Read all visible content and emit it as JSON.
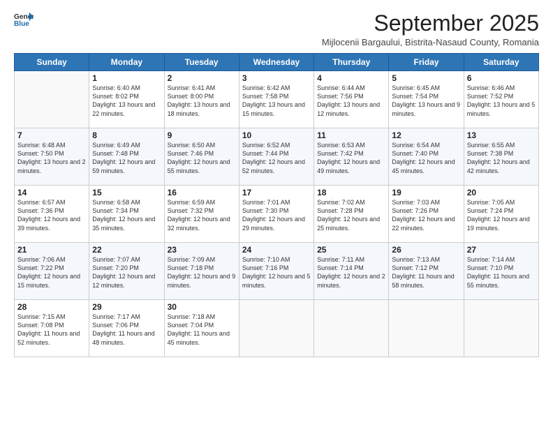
{
  "logo": {
    "line1": "General",
    "line2": "Blue"
  },
  "title": "September 2025",
  "subtitle": "Mijlocenii Bargaului, Bistrita-Nasaud County, Romania",
  "days_header": [
    "Sunday",
    "Monday",
    "Tuesday",
    "Wednesday",
    "Thursday",
    "Friday",
    "Saturday"
  ],
  "weeks": [
    [
      {
        "day": "",
        "info": ""
      },
      {
        "day": "1",
        "info": "Sunrise: 6:40 AM\nSunset: 8:02 PM\nDaylight: 13 hours\nand 22 minutes."
      },
      {
        "day": "2",
        "info": "Sunrise: 6:41 AM\nSunset: 8:00 PM\nDaylight: 13 hours\nand 18 minutes."
      },
      {
        "day": "3",
        "info": "Sunrise: 6:42 AM\nSunset: 7:58 PM\nDaylight: 13 hours\nand 15 minutes."
      },
      {
        "day": "4",
        "info": "Sunrise: 6:44 AM\nSunset: 7:56 PM\nDaylight: 13 hours\nand 12 minutes."
      },
      {
        "day": "5",
        "info": "Sunrise: 6:45 AM\nSunset: 7:54 PM\nDaylight: 13 hours\nand 9 minutes."
      },
      {
        "day": "6",
        "info": "Sunrise: 6:46 AM\nSunset: 7:52 PM\nDaylight: 13 hours\nand 5 minutes."
      }
    ],
    [
      {
        "day": "7",
        "info": "Sunrise: 6:48 AM\nSunset: 7:50 PM\nDaylight: 13 hours\nand 2 minutes."
      },
      {
        "day": "8",
        "info": "Sunrise: 6:49 AM\nSunset: 7:48 PM\nDaylight: 12 hours\nand 59 minutes."
      },
      {
        "day": "9",
        "info": "Sunrise: 6:50 AM\nSunset: 7:46 PM\nDaylight: 12 hours\nand 55 minutes."
      },
      {
        "day": "10",
        "info": "Sunrise: 6:52 AM\nSunset: 7:44 PM\nDaylight: 12 hours\nand 52 minutes."
      },
      {
        "day": "11",
        "info": "Sunrise: 6:53 AM\nSunset: 7:42 PM\nDaylight: 12 hours\nand 49 minutes."
      },
      {
        "day": "12",
        "info": "Sunrise: 6:54 AM\nSunset: 7:40 PM\nDaylight: 12 hours\nand 45 minutes."
      },
      {
        "day": "13",
        "info": "Sunrise: 6:55 AM\nSunset: 7:38 PM\nDaylight: 12 hours\nand 42 minutes."
      }
    ],
    [
      {
        "day": "14",
        "info": "Sunrise: 6:57 AM\nSunset: 7:36 PM\nDaylight: 12 hours\nand 39 minutes."
      },
      {
        "day": "15",
        "info": "Sunrise: 6:58 AM\nSunset: 7:34 PM\nDaylight: 12 hours\nand 35 minutes."
      },
      {
        "day": "16",
        "info": "Sunrise: 6:59 AM\nSunset: 7:32 PM\nDaylight: 12 hours\nand 32 minutes."
      },
      {
        "day": "17",
        "info": "Sunrise: 7:01 AM\nSunset: 7:30 PM\nDaylight: 12 hours\nand 29 minutes."
      },
      {
        "day": "18",
        "info": "Sunrise: 7:02 AM\nSunset: 7:28 PM\nDaylight: 12 hours\nand 25 minutes."
      },
      {
        "day": "19",
        "info": "Sunrise: 7:03 AM\nSunset: 7:26 PM\nDaylight: 12 hours\nand 22 minutes."
      },
      {
        "day": "20",
        "info": "Sunrise: 7:05 AM\nSunset: 7:24 PM\nDaylight: 12 hours\nand 19 minutes."
      }
    ],
    [
      {
        "day": "21",
        "info": "Sunrise: 7:06 AM\nSunset: 7:22 PM\nDaylight: 12 hours\nand 15 minutes."
      },
      {
        "day": "22",
        "info": "Sunrise: 7:07 AM\nSunset: 7:20 PM\nDaylight: 12 hours\nand 12 minutes."
      },
      {
        "day": "23",
        "info": "Sunrise: 7:09 AM\nSunset: 7:18 PM\nDaylight: 12 hours\nand 9 minutes."
      },
      {
        "day": "24",
        "info": "Sunrise: 7:10 AM\nSunset: 7:16 PM\nDaylight: 12 hours\nand 5 minutes."
      },
      {
        "day": "25",
        "info": "Sunrise: 7:11 AM\nSunset: 7:14 PM\nDaylight: 12 hours\nand 2 minutes."
      },
      {
        "day": "26",
        "info": "Sunrise: 7:13 AM\nSunset: 7:12 PM\nDaylight: 11 hours\nand 58 minutes."
      },
      {
        "day": "27",
        "info": "Sunrise: 7:14 AM\nSunset: 7:10 PM\nDaylight: 11 hours\nand 55 minutes."
      }
    ],
    [
      {
        "day": "28",
        "info": "Sunrise: 7:15 AM\nSunset: 7:08 PM\nDaylight: 11 hours\nand 52 minutes."
      },
      {
        "day": "29",
        "info": "Sunrise: 7:17 AM\nSunset: 7:06 PM\nDaylight: 11 hours\nand 48 minutes."
      },
      {
        "day": "30",
        "info": "Sunrise: 7:18 AM\nSunset: 7:04 PM\nDaylight: 11 hours\nand 45 minutes."
      },
      {
        "day": "",
        "info": ""
      },
      {
        "day": "",
        "info": ""
      },
      {
        "day": "",
        "info": ""
      },
      {
        "day": "",
        "info": ""
      }
    ]
  ]
}
